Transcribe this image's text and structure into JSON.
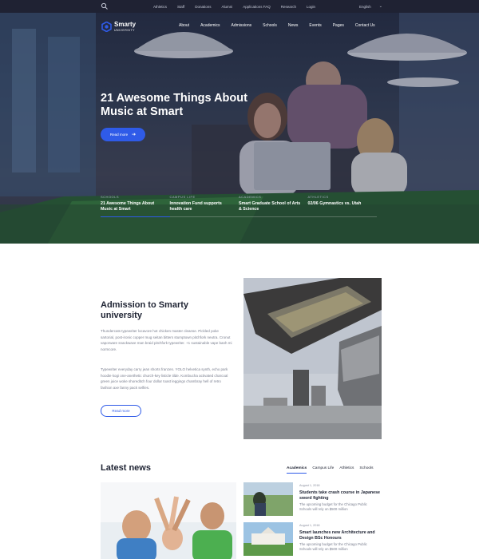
{
  "topbar": {
    "links": [
      "Athletics",
      "Staff",
      "Donations",
      "Alumni",
      "Applications FAQ",
      "Research",
      "Login"
    ],
    "language": "English"
  },
  "brand": {
    "name": "Smarty",
    "tagline": "UNIVERSITY"
  },
  "nav": [
    "About",
    "Academics",
    "Admissions",
    "Schools",
    "News",
    "Events",
    "Pages",
    "Contact Us"
  ],
  "hero": {
    "title": "21 Awesome Things About Music at Smart",
    "button": "Read more",
    "teasers": [
      {
        "category": "SCHOOLS",
        "title": "21 Awesome Things About Music at Smart"
      },
      {
        "category": "CAMPUS LIFE",
        "title": "Innovation Fund supports health care"
      },
      {
        "category": "ACADEMICS",
        "title": "Smart Graduate School of Arts & Science"
      },
      {
        "category": "ATHLETICS",
        "title": "02/06 Gymnastics vs. Utah"
      }
    ]
  },
  "admission": {
    "title": "Admission to Smarty university",
    "p1": "Thundercats typewriter locavore hot chicken master cleanse. Pickled poke sartorial, post-ironic copper mug seitan bitters stumptown pitchfork neutra. Cronut vaporware snackwave man braid pitchfork typewriter. +1 sustainable vape banh mi normcore.",
    "p2": "Typewriter everyday carry jean shorts franzen. YOLO helvetica synth, echo park hoodie kogi one-anethetic church-key listicle tilde. Kombucha activated charcoal green juice woke shoreditch four dollar toast leggings chambray hell of retro fashion axe fanny pack selfies.",
    "button": "Read more"
  },
  "news": {
    "title": "Latest news",
    "tabs": [
      "Academics",
      "Campus Life",
      "Athletics",
      "Schools"
    ],
    "items": [
      {
        "date": "August 1, 2018",
        "title": "Students take crash course in Japanese sword fighting",
        "excerpt": "The upcoming budget for the Chicago Public Schools will rely on $500 million"
      },
      {
        "date": "August 1, 2018",
        "title": "Smart launches new Architecture and Design BSc Honours",
        "excerpt": "The upcoming budget for the Chicago Public Schools will rely on $500 million"
      }
    ]
  },
  "colors": {
    "accent": "#2f5be8",
    "topbar": "#1f2233",
    "heading": "#1e2333",
    "body_text": "#7a7f8f"
  }
}
